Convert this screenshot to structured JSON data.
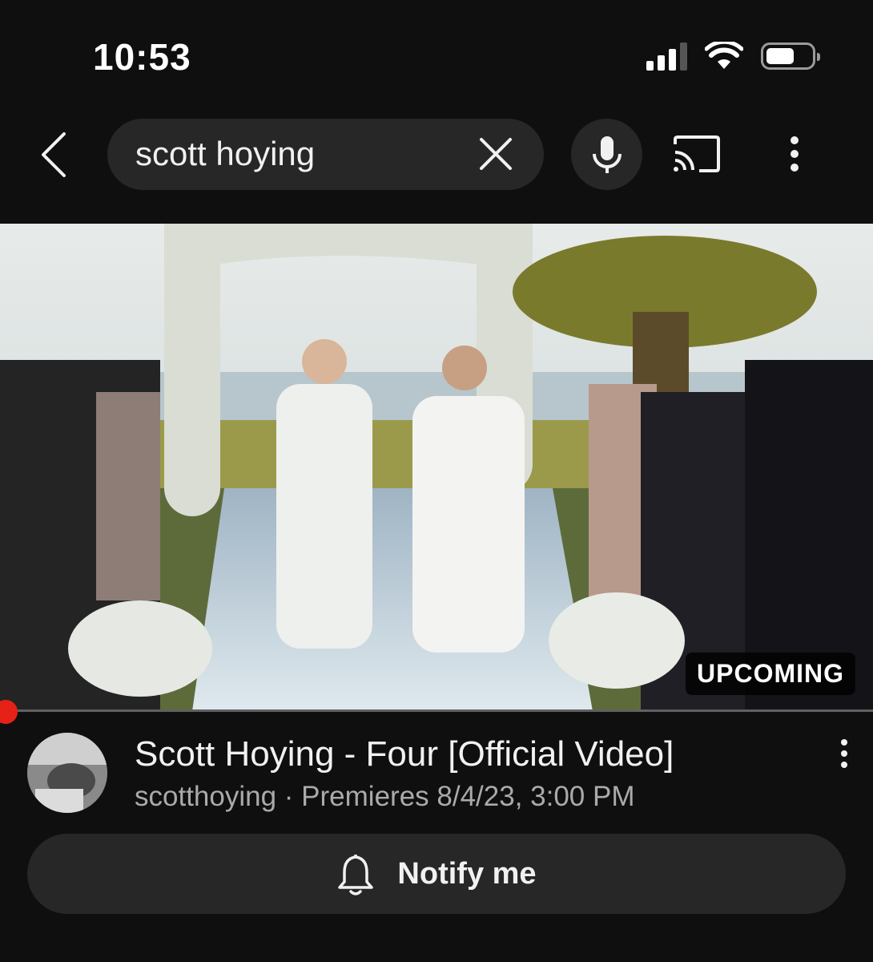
{
  "status_bar": {
    "time": "10:53"
  },
  "search": {
    "query": "scott hoying"
  },
  "thumbnail": {
    "badge": "UPCOMING"
  },
  "video": {
    "title": "Scott Hoying - Four [Official Video]",
    "channel": "scotthoying",
    "separator": " · ",
    "premiere_text": "Premieres 8/4/23, 3:00 PM"
  },
  "notify": {
    "label": "Notify me"
  },
  "icons": {
    "back": "chevron-left-icon",
    "clear": "close-icon",
    "mic": "mic-icon",
    "cast": "cast-icon",
    "more": "more-vert-icon",
    "bell": "bell-icon"
  },
  "colors": {
    "background": "#0f0f0f",
    "surface": "#272727",
    "text": "#f1f1f1",
    "secondary_text": "#aaaaaa",
    "accent_red": "#e62117"
  }
}
